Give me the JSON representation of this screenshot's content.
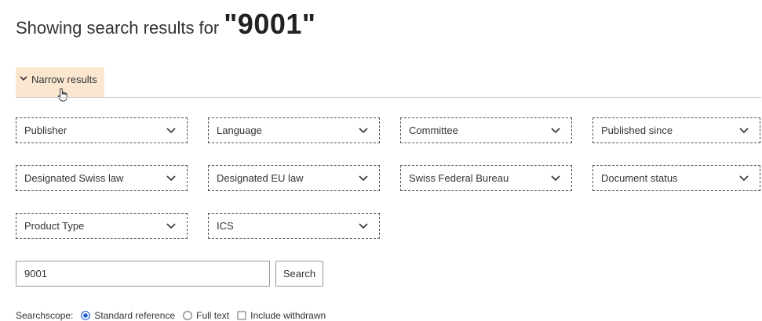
{
  "header": {
    "prefix": "Showing search results for",
    "query": "\"9001\""
  },
  "narrow": {
    "label": "Narrow results",
    "icon": "chevron-down-icon"
  },
  "filters": [
    {
      "label": "Publisher"
    },
    {
      "label": "Language"
    },
    {
      "label": "Committee"
    },
    {
      "label": "Published since"
    },
    {
      "label": "Designated Swiss law"
    },
    {
      "label": "Designated EU law"
    },
    {
      "label": "Swiss Federal Bureau"
    },
    {
      "label": "Document status"
    },
    {
      "label": "Product Type"
    },
    {
      "label": "ICS"
    }
  ],
  "search": {
    "value": "9001",
    "button_label": "Search"
  },
  "scope": {
    "label": "Searchscope:",
    "options": [
      {
        "label": "Standard reference",
        "type": "radio",
        "checked": true
      },
      {
        "label": "Full text",
        "type": "radio",
        "checked": false
      },
      {
        "label": "Include withdrawn",
        "type": "checkbox",
        "checked": false
      }
    ]
  },
  "colors": {
    "narrow_bg": "#fbe7d0",
    "radio_accent": "#1f5fd6"
  }
}
